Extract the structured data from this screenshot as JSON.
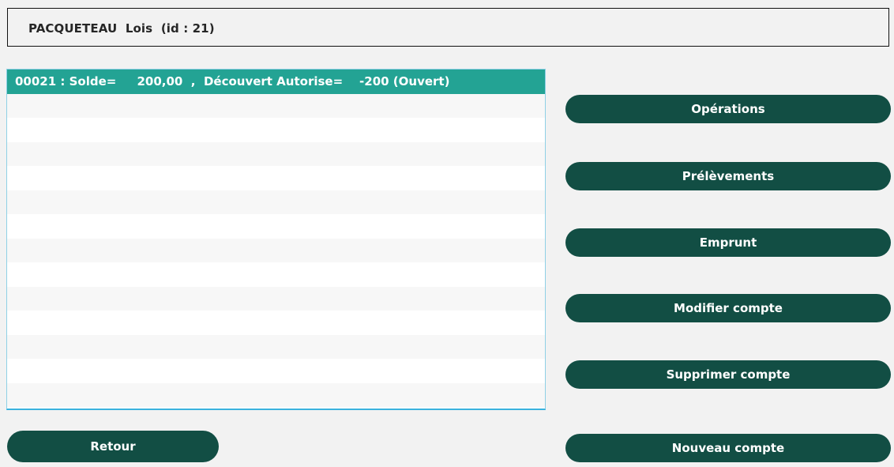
{
  "header": {
    "title": "PACQUETEAU  Lois  (id : 21)"
  },
  "accounts": {
    "selected_row": "00021 : Solde=     200,00  ,  Découvert Autorise=    -200 (Ouvert)"
  },
  "buttons": {
    "operations": "Opérations",
    "prelevements": "Prélèvements",
    "emprunt": "Emprunt",
    "modifier_compte": "Modifier compte",
    "supprimer_compte": "Supprimer compte",
    "nouveau_compte": "Nouveau compte",
    "retour": "Retour"
  },
  "colors": {
    "button_bg": "#124e44",
    "selected_row_bg": "#23a394",
    "page_bg": "#f2f2f2"
  }
}
